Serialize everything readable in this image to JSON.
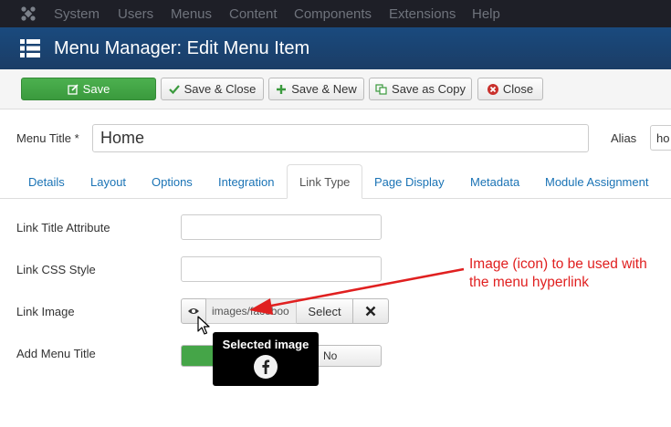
{
  "navbar": {
    "items": [
      "System",
      "Users",
      "Menus",
      "Content",
      "Components",
      "Extensions",
      "Help"
    ]
  },
  "header": {
    "title": "Menu Manager: Edit Menu Item"
  },
  "toolbar": {
    "save": "Save",
    "save_close": "Save & Close",
    "save_new": "Save & New",
    "save_copy": "Save as Copy",
    "close": "Close"
  },
  "form": {
    "menu_title_label": "Menu Title *",
    "menu_title_value": "Home",
    "alias_label": "Alias",
    "alias_value": "ho"
  },
  "tabs": [
    "Details",
    "Layout",
    "Options",
    "Integration",
    "Link Type",
    "Page Display",
    "Metadata",
    "Module Assignment"
  ],
  "active_tab": "Link Type",
  "fields": {
    "link_title_label": "Link Title Attribute",
    "link_css_label": "Link CSS Style",
    "link_image_label": "Link Image",
    "link_image_path": "images/faceboo",
    "select_button": "Select",
    "add_menu_title_label": "Add Menu Title",
    "toggle_no": "No"
  },
  "tooltip": {
    "title": "Selected image"
  },
  "annotation": {
    "text": "Image (icon) to be used with the menu hyperlink"
  },
  "colors": {
    "navbar": "#1e1f27",
    "header": "#1b4575",
    "save_green": "#45a548",
    "link_blue": "#1a73b5",
    "annotation_red": "#e02020"
  },
  "icons": {
    "logo": "joomla-logo-icon",
    "header": "menu-list-icon",
    "save": "edit-icon",
    "save_close": "check-icon",
    "save_new": "plus-icon",
    "save_copy": "copy-icon",
    "close": "close-circle-icon",
    "preview": "eye-icon",
    "clear": "x-icon",
    "tooltip_image": "facebook-icon"
  }
}
